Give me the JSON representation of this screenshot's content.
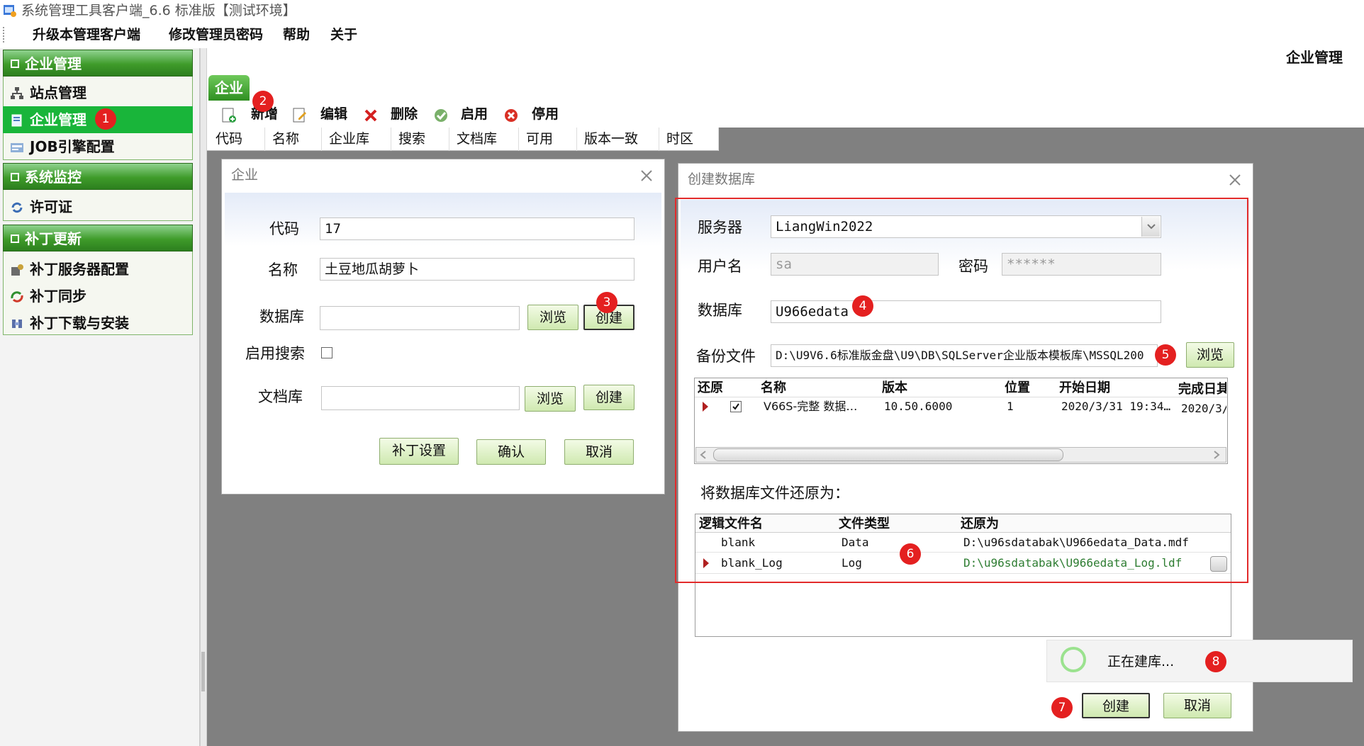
{
  "window": {
    "title": "系统管理工具客户端_6.6 标准版【测试环境】"
  },
  "menu": {
    "items": [
      "升级本管理客户端",
      "修改管理员密码",
      "帮助",
      "关于"
    ]
  },
  "sidebar": {
    "groups": [
      {
        "title": "企业管理",
        "items": [
          {
            "label": "站点管理",
            "icon": "sitemap-icon"
          },
          {
            "label": "企业管理",
            "icon": "enterprise-icon",
            "active": true
          },
          {
            "label": "JOB引擎配置",
            "icon": "job-engine-icon"
          }
        ]
      },
      {
        "title": "系统监控",
        "items": [
          {
            "label": "许可证",
            "icon": "license-icon"
          }
        ]
      },
      {
        "title": "补丁更新",
        "items": [
          {
            "label": "补丁服务器配置",
            "icon": "patch-server-icon"
          },
          {
            "label": "补丁同步",
            "icon": "patch-sync-icon"
          },
          {
            "label": "补丁下载与安装",
            "icon": "patch-download-icon"
          }
        ]
      }
    ]
  },
  "main": {
    "page_title": "企业管理",
    "tab_label": "企业",
    "toolbar": {
      "add": "新增",
      "edit": "编辑",
      "delete": "删除",
      "enable": "启用",
      "disable": "停用"
    },
    "columns": [
      "代码",
      "名称",
      "企业库",
      "搜索",
      "文档库",
      "可用",
      "版本一致",
      "时区"
    ]
  },
  "enterprise_dialog": {
    "title": "企业",
    "code_label": "代码",
    "code_value": "17",
    "name_label": "名称",
    "name_value": "土豆地瓜胡萝卜",
    "db_label": "数据库",
    "db_value": "",
    "browse": "浏览",
    "create": "创建",
    "search_label": "启用搜索",
    "doclib_label": "文档库",
    "doclib_value": "",
    "patch_settings": "补丁设置",
    "confirm": "确认",
    "cancel": "取消"
  },
  "createdb_dialog": {
    "title": "创建数据库",
    "server_label": "服务器",
    "server_value": "LiangWin2022",
    "user_label": "用户名",
    "user_value": "sa",
    "pwd_label": "密码",
    "pwd_value": "******",
    "db_label": "数据库",
    "db_value": "U966edata",
    "backup_label": "备份文件",
    "backup_value": "D:\\U9V6.6标准版金盘\\U9\\DB\\SQLServer企业版本模板库\\MSSQL200",
    "browse": "浏览",
    "backup_grid": {
      "headers": [
        "还原",
        "名称",
        "版本",
        "位置",
        "开始日期",
        "完成日其"
      ],
      "rows": [
        {
          "checked": true,
          "name": "V66S-完整 数据…",
          "version": "10.50.6000",
          "position": "1",
          "start": "2020/3/31 19:34…",
          "finish": "2020/3/"
        }
      ]
    },
    "restore_label": "将数据库文件还原为：",
    "file_grid": {
      "headers": [
        "逻辑文件名",
        "文件类型",
        "还原为"
      ],
      "rows": [
        {
          "logical": "blank",
          "type": "Data",
          "restore": "D:\\u96sdatabak\\U966edata_Data.mdf"
        },
        {
          "logical": "blank_Log",
          "type": "Log",
          "restore": "D:\\u96sdatabak\\U966edata_Log.ldf"
        }
      ]
    },
    "create": "创建",
    "cancel": "取消"
  },
  "toast": {
    "text": "正在建库..."
  },
  "badges": [
    "1",
    "2",
    "3",
    "4",
    "5",
    "6",
    "7",
    "8"
  ],
  "colors": {
    "accent_green": "#19b53a",
    "annotation_red": "#e42020",
    "highlight_border": "#e22b2b"
  }
}
